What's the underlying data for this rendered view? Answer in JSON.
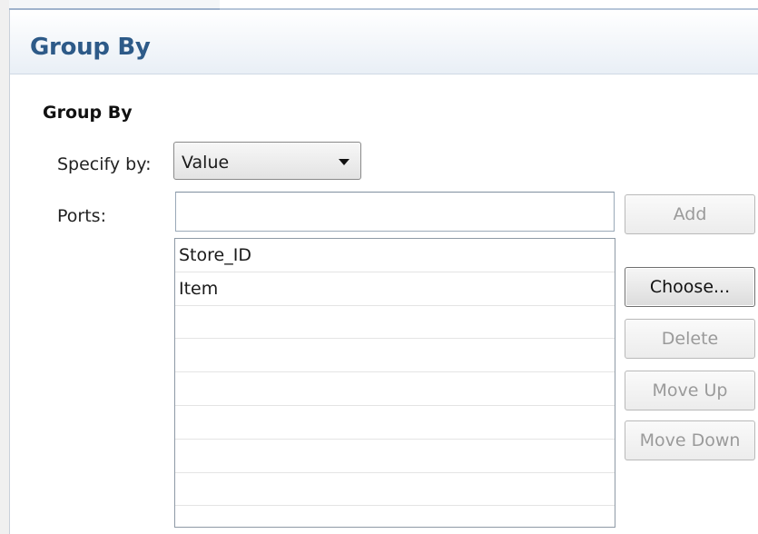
{
  "header": {
    "title": "Group By"
  },
  "section": {
    "title": "Group By"
  },
  "specify_by": {
    "label": "Specify by:",
    "value": "Value"
  },
  "ports": {
    "label": "Ports:",
    "input_value": "",
    "items": [
      "Store_ID",
      "Item",
      "",
      "",
      "",
      "",
      "",
      "",
      ""
    ]
  },
  "buttons": {
    "add": "Add",
    "choose": "Choose...",
    "delete": "Delete",
    "move_up": "Move Up",
    "move_down": "Move Down"
  },
  "icons": {
    "dropdown": "chevron-down-icon"
  }
}
